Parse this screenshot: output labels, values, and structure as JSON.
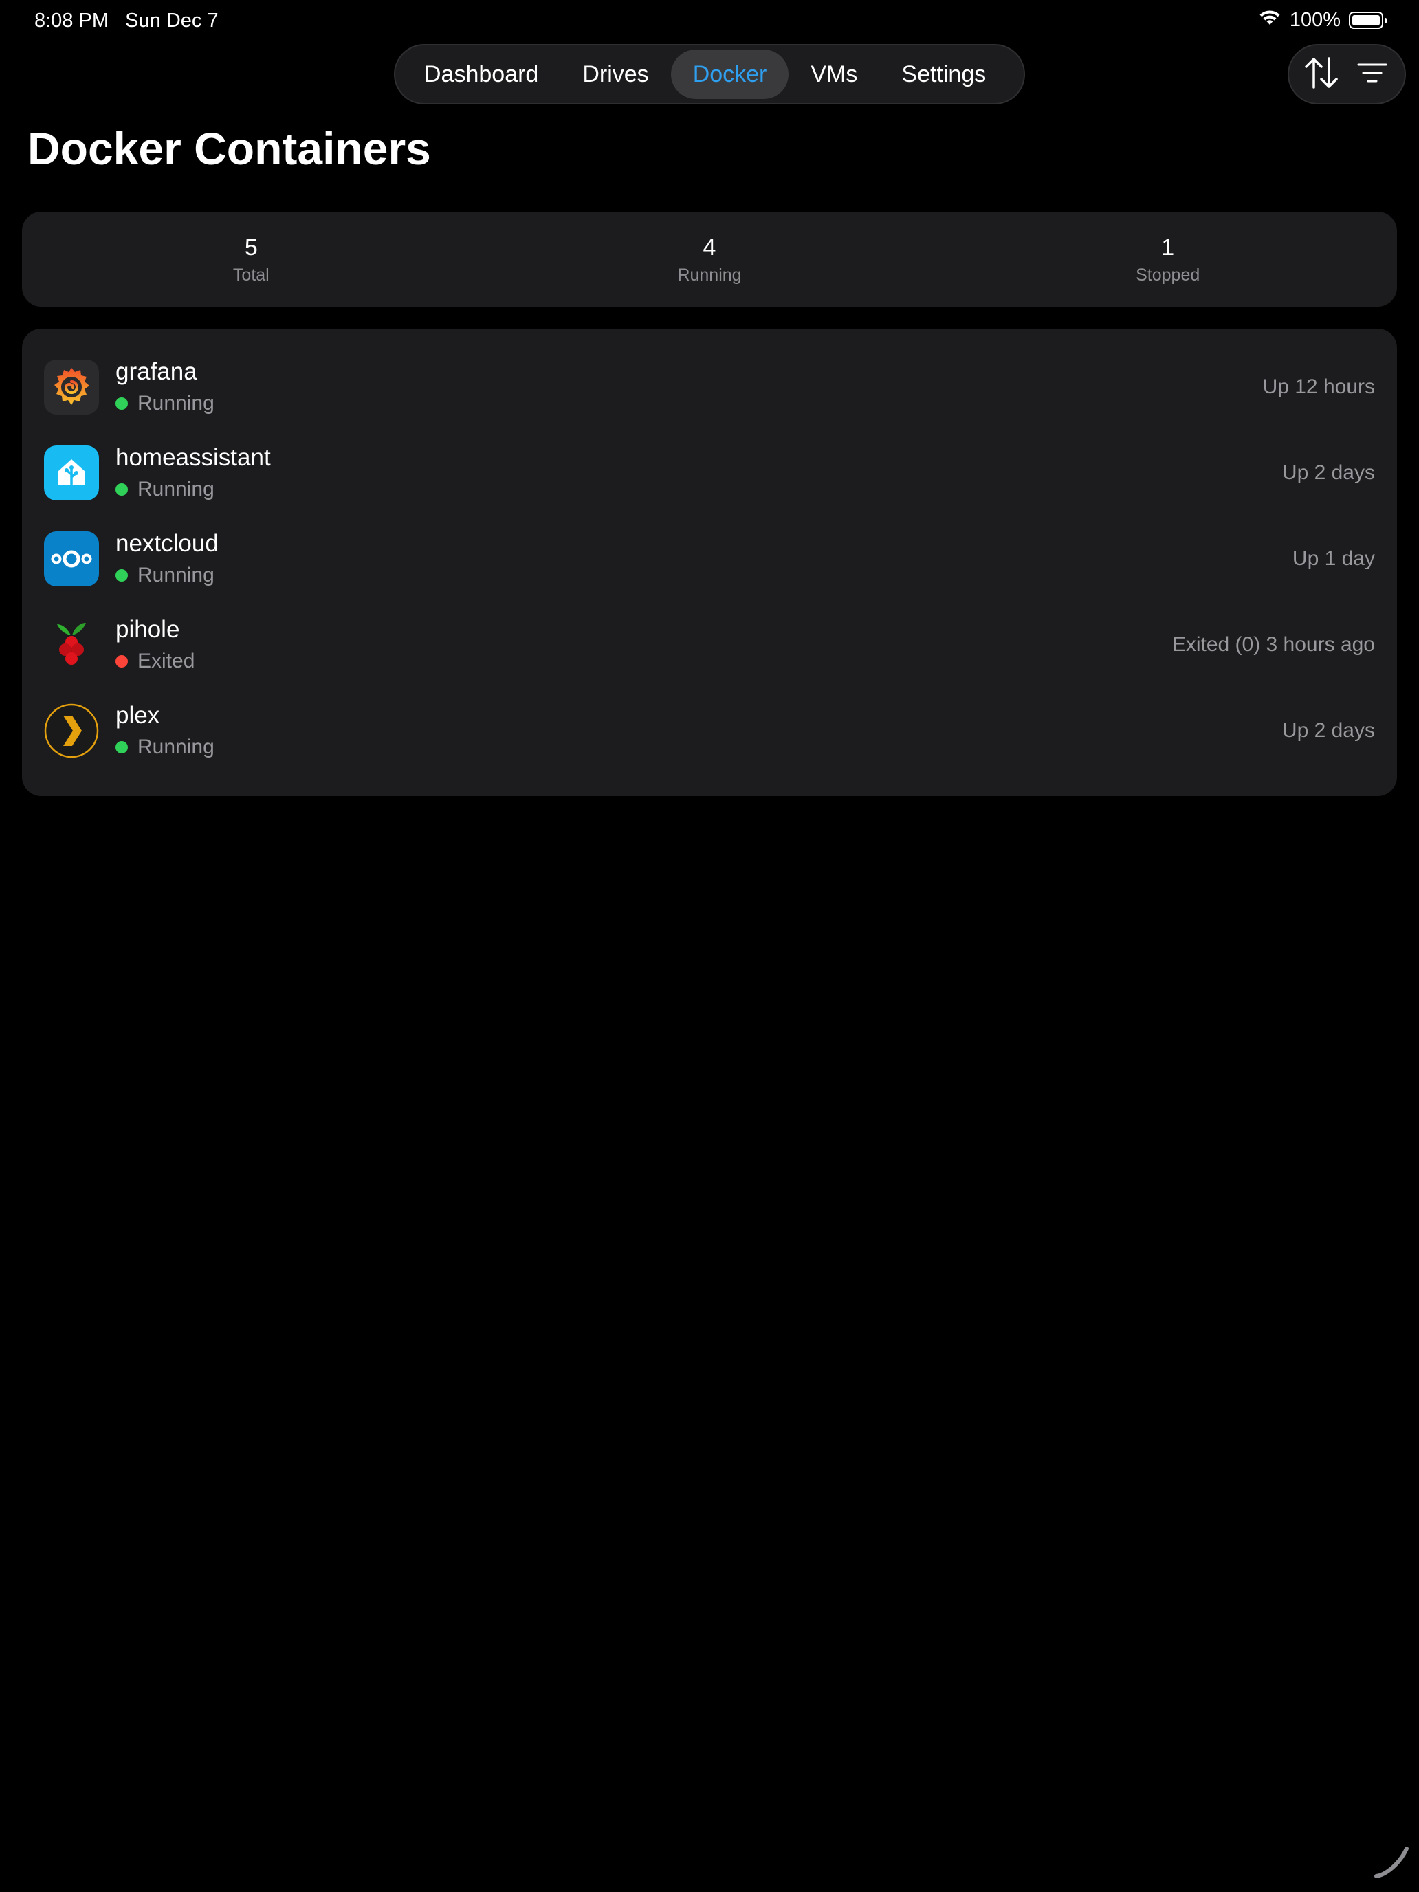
{
  "status_bar": {
    "time": "8:08 PM",
    "date": "Sun Dec 7",
    "battery": "100%",
    "wifi_icon": "wifi-icon",
    "battery_icon": "battery-icon"
  },
  "nav": {
    "tabs": [
      {
        "label": "Dashboard",
        "active": false
      },
      {
        "label": "Drives",
        "active": false
      },
      {
        "label": "Docker",
        "active": true
      },
      {
        "label": "VMs",
        "active": false
      },
      {
        "label": "Settings",
        "active": false
      }
    ]
  },
  "toolbar": {
    "sort_icon": "sort-arrows-icon",
    "filter_icon": "filter-lines-icon"
  },
  "page": {
    "title": "Docker Containers"
  },
  "summary": {
    "total": {
      "value": "5",
      "label": "Total"
    },
    "running": {
      "value": "4",
      "label": "Running"
    },
    "stopped": {
      "value": "1",
      "label": "Stopped"
    }
  },
  "containers": [
    {
      "name": "grafana",
      "status": "Running",
      "uptime": "Up 12 hours",
      "icon": "grafana-icon",
      "status_color": "#30d158"
    },
    {
      "name": "homeassistant",
      "status": "Running",
      "uptime": "Up 2 days",
      "icon": "homeassistant-icon",
      "status_color": "#30d158"
    },
    {
      "name": "nextcloud",
      "status": "Running",
      "uptime": "Up 1 day",
      "icon": "nextcloud-icon",
      "status_color": "#30d158"
    },
    {
      "name": "pihole",
      "status": "Exited",
      "uptime": "Exited (0) 3 hours ago",
      "icon": "pihole-icon",
      "status_color": "#ff453a"
    },
    {
      "name": "plex",
      "status": "Running",
      "uptime": "Up 2 days",
      "icon": "plex-icon",
      "status_color": "#30d158"
    }
  ],
  "colors": {
    "accent": "#2f9ff0",
    "running": "#30d158",
    "exited": "#ff453a",
    "card": "#1c1c1e"
  }
}
